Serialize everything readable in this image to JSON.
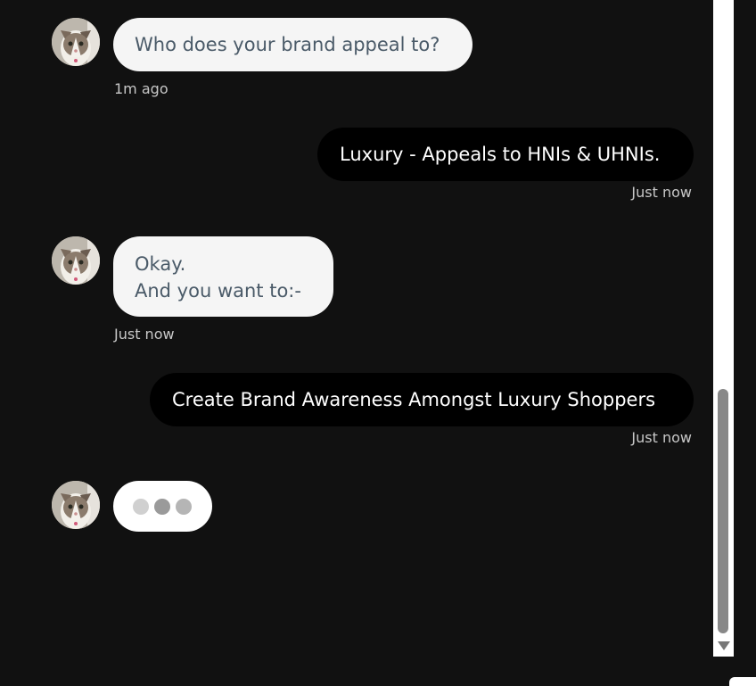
{
  "messages": [
    {
      "sender": "bot",
      "text": "Who does your brand appeal to?",
      "time": "1m ago"
    },
    {
      "sender": "user",
      "text": "Luxury - Appeals to HNIs & UHNIs.",
      "time": "Just now"
    },
    {
      "sender": "bot",
      "line1": "Okay.",
      "line2": "And you want to:-",
      "time": "Just now"
    },
    {
      "sender": "user",
      "text": "Create Brand Awareness Amongst Luxury Shoppers",
      "time": "Just now"
    }
  ],
  "typing_indicator": {
    "dots": [
      "#d0d0d0",
      "#9a9a9a",
      "#b5b5b5"
    ]
  },
  "colors": {
    "background": "#111111",
    "bot_bubble": "#f5f5f5",
    "bot_text": "#4a5a68",
    "user_bubble": "#000000",
    "user_text": "#ffffff",
    "timestamp": "#c8c8c8"
  },
  "avatar": {
    "icon": "cat-avatar-icon"
  }
}
